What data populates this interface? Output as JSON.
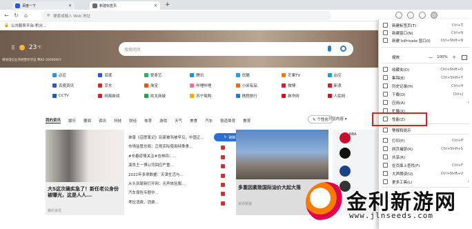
{
  "tabs": [
    {
      "label": "百度一下",
      "active": false
    },
    {
      "label": "新建标签页",
      "active": true
    }
  ],
  "toolbar": {
    "address_placeholder": "搜索或输入 Web 地址"
  },
  "favorites": {
    "item": "公共服务平台-积分..."
  },
  "hero": {
    "temperature": "23",
    "unit": "℃",
    "search_placeholder": "搜索网页",
    "subtitle": "增值电信业务经营许可证 粤B2-20090007"
  },
  "quick_links": [
    {
      "label": "必应",
      "color": "#1a9fd6"
    },
    {
      "label": "百度",
      "color": "#2b56d6"
    },
    {
      "label": "爱奇艺",
      "color": "#1bb76a"
    },
    {
      "label": "腾讯",
      "color": "#1d90e6"
    },
    {
      "label": "优酷",
      "color": "#1c9df0"
    },
    {
      "label": "芒果TV",
      "color": "#ff7a00"
    },
    {
      "label": "必应",
      "color": "#1a9fd6"
    },
    {
      "label": "百度资讯",
      "color": "#2b56d6"
    },
    {
      "label": "京东",
      "color": "#e1251b"
    },
    {
      "label": "淘宝",
      "color": "#ff5000"
    },
    {
      "label": "哔哩哔哩",
      "color": "#fb7299"
    },
    {
      "label": "小米有品",
      "color": "#ff6700"
    },
    {
      "label": "微博",
      "color": "#e6162d"
    },
    {
      "label": "新浪",
      "color": "#e6162d"
    },
    {
      "label": "CCTV",
      "color": "#1d5bbf"
    },
    {
      "label": "网易新闻",
      "color": "#d4222a"
    },
    {
      "label": "欢太商城",
      "color": "#1ba84d"
    },
    {
      "label": "苏宁易购",
      "color": "#ffaa00"
    },
    {
      "label": "携程旅行",
      "color": "#2577e3"
    },
    {
      "label": "新华网",
      "color": "#c81623"
    },
    {
      "label": "人民网",
      "color": "#c81623"
    }
  ],
  "news_tabs": [
    "我的资讯",
    "娱乐",
    "要闻",
    "资讯",
    "科技",
    "财经",
    "体育",
    "游戏",
    "天气",
    "美食",
    "汽车",
    "铁道体育",
    "教育"
  ],
  "news_controls": {
    "personalize": "个性化",
    "content": "可见内容"
  },
  "card1": {
    "headline": "大S这次确实急了！新任老公身份被曝光，这是人人...",
    "source": "娱乐资讯"
  },
  "news_list": [
    "抹香《這麽笔记》玩家被骂被罕见，中国正...",
    "市场监管总局：正规实际使用特殊食...",
    "#长春疫情关注#吉林四：...",
    "演员王一博公司回应严重...",
    "2022年多项数据：天津生活与...",
    "从头到尾新打开网：无声体验服...",
    "汽车保险专题中...",
    "考拉消费、消费..."
  ],
  "loading_pill": "刷新故事",
  "card2": {
    "headline": "多重因素致国际油价大起大落",
    "source": "资讯频道"
  },
  "sports": {
    "league": "NBA"
  },
  "menu": {
    "items": [
      {
        "label": "新建标签页(T)",
        "shortcut": "Ctrl+T"
      },
      {
        "label": "新建窗口(N)",
        "shortcut": "Ctrl+N"
      },
      {
        "label": "新建 InPrivate 窗口(I)",
        "shortcut": "Ctrl+Shift+N"
      },
      {
        "label": "收藏夹(O)",
        "shortcut": "Ctrl+Shift+O"
      },
      {
        "label": "集锦(E)",
        "shortcut": "Ctrl+Shift+Y"
      },
      {
        "label": "历史记录(H)",
        "shortcut": "Ctrl+H"
      },
      {
        "label": "下载(D)",
        "shortcut": "Ctrl+J"
      },
      {
        "label": "应用(A)",
        "shortcut": ""
      },
      {
        "label": "扩展(X)",
        "shortcut": ""
      },
      {
        "label": "性能(Z)",
        "shortcut": ""
      },
      {
        "label": "警报和提示",
        "shortcut": ""
      },
      {
        "label": "打印(P)",
        "shortcut": "Ctrl+P"
      },
      {
        "label": "网页捕获(R)",
        "shortcut": "Ctrl+Shift+S"
      },
      {
        "label": "共享(R)",
        "shortcut": ""
      },
      {
        "label": "在页面上查找(F)",
        "shortcut": "Ctrl+F"
      },
      {
        "label": "大声朗读(U)",
        "shortcut": "Ctrl+Shift+U"
      },
      {
        "label": "更多工具(L)",
        "shortcut": ""
      }
    ],
    "zoom": {
      "label": "缩放",
      "value": "100%",
      "minus": "—",
      "plus": "+"
    }
  },
  "watermark": {
    "title": "金利新游网",
    "url": "www.jlnseeds.com"
  }
}
